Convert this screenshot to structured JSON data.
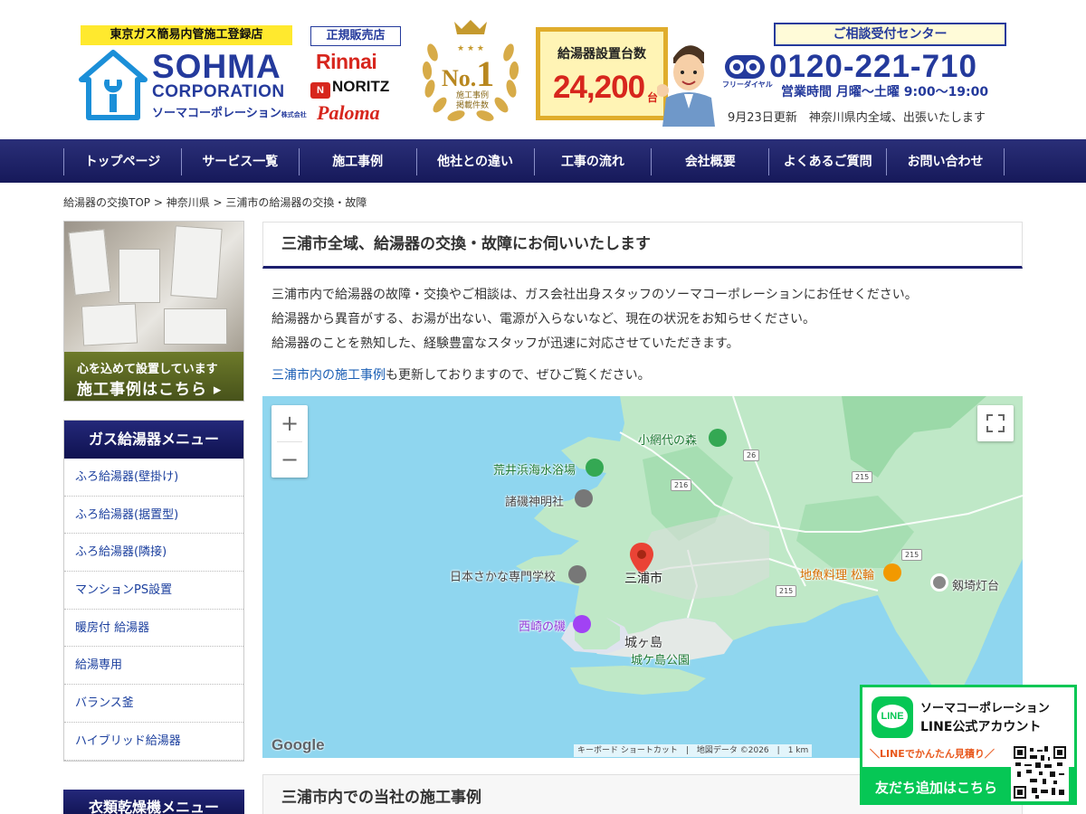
{
  "header": {
    "registration": "東京ガス簡易内管施工登録店",
    "logo_name": "SOHMA",
    "logo_corp": "CORPORATION",
    "logo_kana": "ソーマコーポレーション",
    "logo_kana_suffix": "株式会社",
    "dealer_title": "正規販売店",
    "brands": [
      "Rinnai",
      "NORITZ",
      "Paloma"
    ],
    "noritz_mark": "N",
    "no1_prefix": "No.",
    "no1_num": "1",
    "no1_sub": "施工事例\n掲載件数",
    "count_label": "給湯器設置台数",
    "count_value": "24,200",
    "count_unit": "台",
    "consult_title": "ご相談受付センター",
    "freedial_label": "フリーダイヤル",
    "phone": "0120-221-710",
    "hours": "営業時間 月曜～土曜 9:00～19:00",
    "update": "9月23日更新　神奈川県内全域、出張いたします"
  },
  "nav": {
    "items": [
      "トップページ",
      "サービス一覧",
      "施工事例",
      "他社との違い",
      "工事の流れ",
      "会社概要",
      "よくあるご質問",
      "お問い合わせ"
    ]
  },
  "breadcrumb": "給湯器の交換TOP > 神奈川県 > 三浦市の給湯器の交換・故障",
  "sidebar": {
    "banner_line1": "心を込めて設置しています",
    "banner_line2": "施工事例はこちら ▸",
    "menu_title": "ガス給湯器メニュー",
    "menu_items": [
      "ふろ給湯器(壁掛け)",
      "ふろ給湯器(据置型)",
      "ふろ給湯器(隣接)",
      "マンションPS設置",
      "暖房付 給湯器",
      "給湯専用",
      "バランス釜",
      "ハイブリッド給湯器"
    ],
    "menu_title_2": "衣類乾燥機メニュー"
  },
  "main": {
    "heading": "三浦市全域、給湯器の交換・故障にお伺いいたします",
    "intro_lines": [
      "三浦市内で給湯器の故障・交換やご相談は、ガス会社出身スタッフのソーマコーポレーションにお任せください。",
      "給湯器から異音がする、お湯が出ない、電源が入らないなど、現在の状況をお知らせください。",
      "給湯器のことを熟知した、経験豊富なスタッフが迅速に対応させていただきます。"
    ],
    "link_text": "三浦市内の施工事例",
    "link_suffix": "も更新しておりますので、ぜひご覧ください。",
    "heading_2": "三浦市内での当社の施工事例"
  },
  "map": {
    "zoom_in": "+",
    "zoom_out": "−",
    "places": {
      "koajiro": "小網代の森",
      "arai": "荒井浜海水浴場",
      "moroiso": "諸磯神明社",
      "school": "日本さかな専門学校",
      "miura": "三浦市",
      "restaurant": "地魚料理 松輪",
      "lighthouse": "剱埼灯台",
      "nishizaki": "西崎の磯",
      "jogashima": "城ヶ島",
      "jogashima_park": "城ケ島公園"
    },
    "roads": [
      "26",
      "216",
      "215",
      "215",
      "215"
    ],
    "logo": "Google",
    "attribution": "キーボード ショートカット　|　地図データ ©2026　|　1 km"
  },
  "line_widget": {
    "logo": "LINE",
    "name": "ソーマコーポレーション",
    "official": "LINE公式アカウント",
    "easy": "＼LINEでかんたん見積り／",
    "cta": "友だち追加はこちら"
  },
  "colors": {
    "brand_blue": "#243a9c",
    "nav": "#1c1f6e",
    "accent_red": "#d7261d",
    "line_green": "#06c755"
  }
}
